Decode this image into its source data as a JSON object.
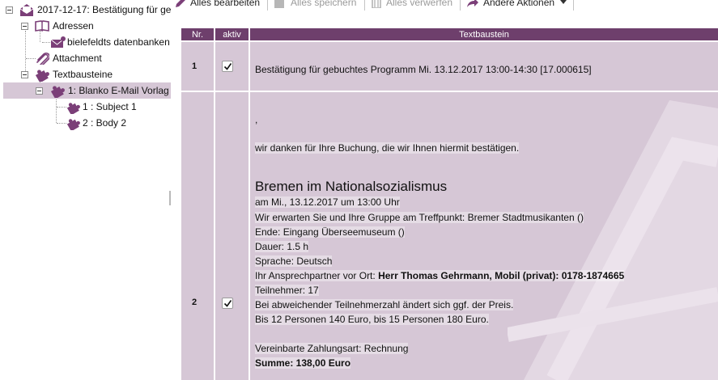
{
  "tree": {
    "root": "2017-12-17: Bestätigung für ge",
    "adressen": "Adressen",
    "contact": "bielefeldts datenbanken",
    "attachment": "Attachment",
    "textbausteine": "Textbausteine",
    "template": "1: Blanko E-Mail Vorlag",
    "subject": "1 : Subject 1",
    "body": "2 : Body 2"
  },
  "toolbar": {
    "edit_all": "Alles bearbeiten",
    "save_all": "Alles speichern",
    "discard_all": "Alles verwerfen",
    "other_actions": "Andere Aktionen"
  },
  "grid": {
    "headers": {
      "nr": "Nr.",
      "active": "aktiv",
      "text": "Textbaustein"
    },
    "rows": [
      {
        "nr": "1",
        "active": true,
        "text": "Bestätigung für gebuchtes Programm Mi. 13.12.2017 13:00-14:30 [17.000615]"
      },
      {
        "nr": "2",
        "active": true,
        "salutation": ",",
        "intro": "wir danken für Ihre Buchung, die wir Ihnen hiermit bestätigen.",
        "title": "Bremen im Nationalsozialismus",
        "date": "am Mi., 13.12.2017 um 13:00 Uhr",
        "meeting": "Wir erwarten Sie und Ihre Gruppe am Treffpunkt: Bremer Stadtmusikanten ()",
        "end": "Ende: Eingang Überseemuseum ()",
        "duration": "Dauer: 1.5 h",
        "language": "Sprache: Deutsch",
        "contact_prefix": "Ihr Ansprechpartner vor Ort: ",
        "contact_name": "Herr Thomas Gehrmann, Mobil (privat): 0178-1874665",
        "participants": "Teilnehmer: 17",
        "deviation": "Bei abweichender Teilnehmerzahl ändert sich ggf. der Preis.",
        "prices": "Bis 12 Personen 140 Euro, bis 15 Personen 180 Euro.",
        "payment": "Vereinbarte Zahlungsart: Rechnung",
        "total": "Summe: 138,00 Euro"
      }
    ]
  },
  "colors": {
    "header_bg": "#6e3f6c",
    "row_bg": "#d6c7d6",
    "icon_purple": "#7b3f78"
  },
  "icons": [
    "envelope-open-icon",
    "address-book-icon",
    "envelope-icon",
    "paperclip-icon",
    "puzzle-icon",
    "pencil-icon",
    "save-icon",
    "trash-icon",
    "share-icon",
    "caret-down-icon",
    "checkmark-icon"
  ]
}
